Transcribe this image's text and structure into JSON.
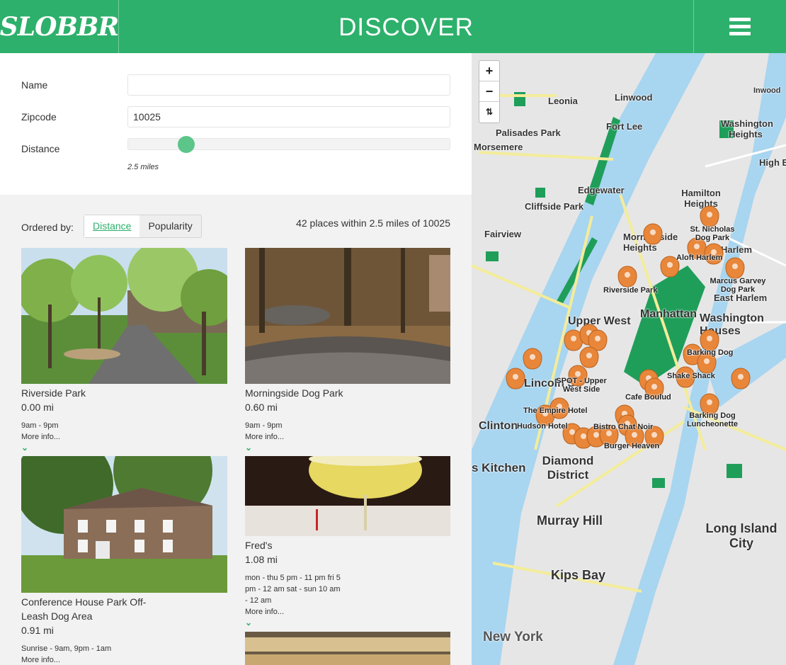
{
  "header": {
    "logo_text": "SLOBBR",
    "title": "DISCOVER"
  },
  "filters": {
    "name_label": "Name",
    "name_value": "",
    "zip_label": "Zipcode",
    "zip_value": "10025",
    "distance_label": "Distance",
    "distance_value_text": "2.5 miles",
    "distance_fraction": 0.18
  },
  "ordering": {
    "label": "Ordered by:",
    "options": [
      "Distance",
      "Popularity"
    ],
    "selected": "Distance",
    "results_text": "42 places within 2.5 miles of 10025"
  },
  "places": [
    {
      "name": "Riverside Park",
      "distance": "0.00 mi",
      "hours": "9am - 9pm",
      "more": "More info..."
    },
    {
      "name": "Morningside Dog Park",
      "distance": "0.60 mi",
      "hours": "9am - 9pm",
      "more": "More info..."
    },
    {
      "name": "Conference House Park Off-Leash Dog Area",
      "distance": "0.91 mi",
      "hours": "Sunrise - 9am, 9pm - 1am",
      "more": "More info..."
    },
    {
      "name": "Fred's",
      "distance": "1.08 mi",
      "hours": "mon - thu 5 pm - 11 pm fri 5 pm - 12 am sat - sun 10 am - 12 am",
      "more": "More info..."
    }
  ],
  "map": {
    "controls": {
      "zoom_in": "+",
      "zoom_out": "−",
      "reset": "⇅"
    },
    "labels": [
      "Leonia",
      "Linwood",
      "Fort Lee",
      "Palisades Park",
      "Morsemere",
      "Washington Heights",
      "High B",
      "Inwood",
      "Edgewater",
      "Hamilton Heights",
      "Cliffside Park",
      "Fairview",
      "Morningside Heights",
      "Harlem",
      "East Harlem",
      "Manhattan",
      "Upper West",
      "Washington Houses",
      "Lincoln Sq",
      "Clinton",
      "s Kitchen",
      "Diamond District",
      "Murray Hill",
      "Kips Bay",
      "Long Island City",
      "New York"
    ],
    "pois": [
      "St. Nicholas Dog Park",
      "Aloft Harlem",
      "Marcus Garvey Dog Park",
      "Riverside Park",
      "Barking Dog",
      "Shake Shack",
      "SPOT - Upper West Side",
      "Cafe Boulud",
      "The Empire Hotel",
      "Hudson Hotel",
      "Bistro Chat Noir",
      "Burger Heaven",
      "Barking Dog Luncheonette"
    ],
    "colors": {
      "park": "#1f9e5a",
      "water": "#a8d5f0",
      "land": "#e5e5e5",
      "pin": "#e8863a",
      "road": "#f6f0a8"
    }
  }
}
